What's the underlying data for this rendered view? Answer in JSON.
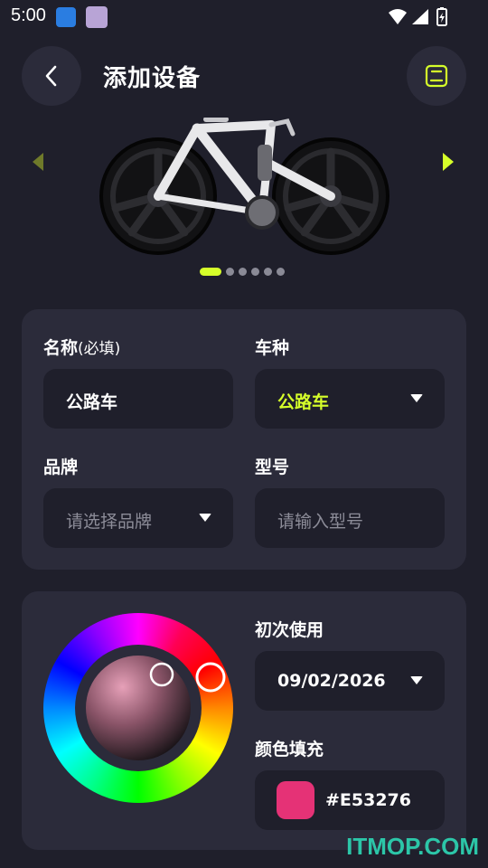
{
  "status_bar": {
    "time": "5:00"
  },
  "header": {
    "title": "添加设备"
  },
  "carousel": {
    "dot_count": 6,
    "active_index": 0
  },
  "form": {
    "name_label": "名称",
    "name_hint": "(必填)",
    "name_value": "公路车",
    "type_label": "车种",
    "type_value": "公路车",
    "brand_label": "品牌",
    "brand_placeholder": "请选择品牌",
    "model_label": "型号",
    "model_placeholder": "请输入型号"
  },
  "details": {
    "first_use_label": "初次使用",
    "first_use_value": "09/02/2026",
    "color_label": "颜色填充",
    "color_value": "#E53276"
  },
  "colors": {
    "accent": "#d6ff2a",
    "background": "#1f1f2b",
    "card": "#2b2b3a",
    "selected_color": "#E53276"
  },
  "watermark": "ITMOP.COM"
}
